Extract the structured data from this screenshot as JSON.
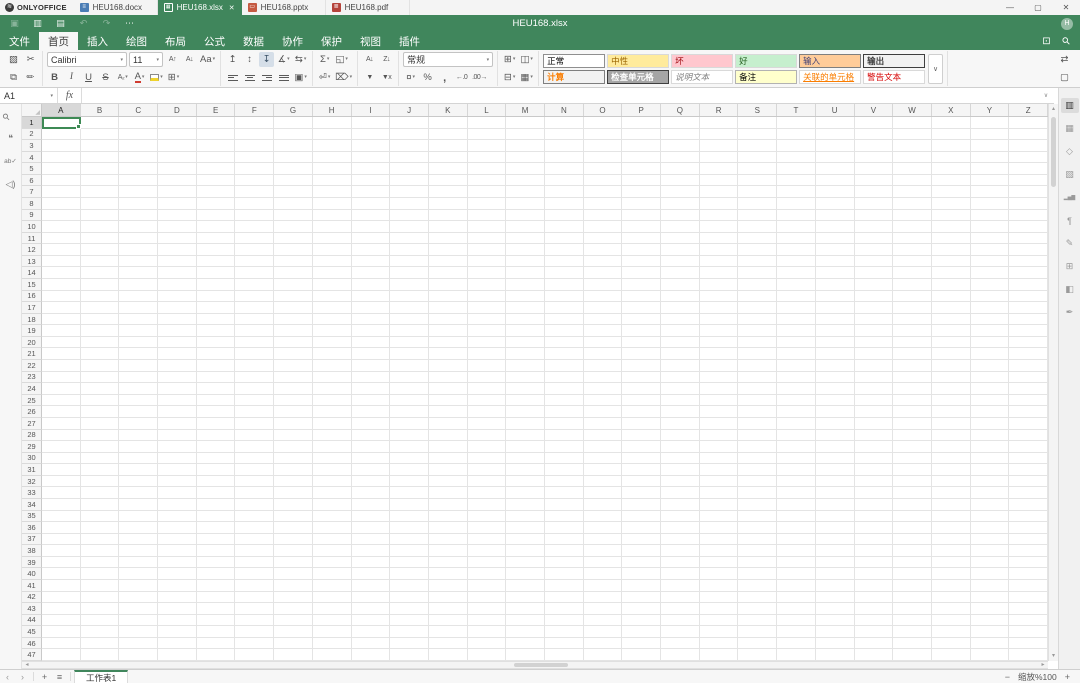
{
  "window": {
    "brand": "ONLYOFFICE",
    "logo_glyph": "≋",
    "tabs": [
      {
        "id": "docx",
        "label": "HEU168.docx",
        "icon_color": "#4a7db5",
        "icon_glyph": "≡",
        "active": false
      },
      {
        "id": "xlsx",
        "label": "HEU168.xlsx",
        "icon_color": "#40865c",
        "icon_glyph": "▦",
        "active": true,
        "close_glyph": "✕"
      },
      {
        "id": "pptx",
        "label": "HEU168.pptx",
        "icon_color": "#c55a42",
        "icon_glyph": "▭",
        "active": false
      },
      {
        "id": "pdf",
        "label": "HEU168.pdf",
        "icon_color": "#b5433b",
        "icon_glyph": "≣",
        "active": false
      }
    ],
    "controls": {
      "minimize": "—",
      "maximize": "▢",
      "close": "✕"
    }
  },
  "header": {
    "title": "HEU168.xlsx",
    "avatar_initial": "H"
  },
  "quick_access": {
    "save": "▣",
    "print": "▥",
    "quick_print": "▤",
    "undo": "↶",
    "redo": "↷",
    "more": "⋯"
  },
  "menu": {
    "items": [
      {
        "id": "file",
        "label": "文件",
        "active": false
      },
      {
        "id": "home",
        "label": "首页",
        "active": true
      },
      {
        "id": "insert",
        "label": "插入",
        "active": false
      },
      {
        "id": "draw",
        "label": "绘图",
        "active": false
      },
      {
        "id": "layout",
        "label": "布局",
        "active": false
      },
      {
        "id": "formula",
        "label": "公式",
        "active": false
      },
      {
        "id": "data",
        "label": "数据",
        "active": false
      },
      {
        "id": "collaboration",
        "label": "协作",
        "active": false
      },
      {
        "id": "protection",
        "label": "保护",
        "active": false
      },
      {
        "id": "view",
        "label": "视图",
        "active": false
      },
      {
        "id": "plugins",
        "label": "插件",
        "active": false
      }
    ],
    "right_icons": {
      "open_location": "⊡",
      "search": "⚲"
    }
  },
  "toolbar": {
    "font_name": "Calibri",
    "font_size": "11",
    "number_format": "常规",
    "icons": {
      "paste": "▧",
      "cut": "✂",
      "copy": "⧉",
      "format_painter": "✏",
      "font_grow": "A↑",
      "font_shrink": "A↓",
      "change_case": "Aa",
      "bold": "B",
      "italic": "I",
      "underline": "U",
      "strike": "S",
      "subscript": "A₂",
      "font_color": "A",
      "borders": "⊞",
      "valign_top": "↥",
      "valign_middle": "↕",
      "valign_bottom": "↧",
      "orientation": "∡",
      "text_direction": "⇆",
      "merge": "▣",
      "autosum": "Σ",
      "named_ranges": "◱",
      "wrap_text": "⏎",
      "clear": "⌦",
      "sort_asc": "A↓",
      "sort_desc": "Z↓",
      "filter": "▼",
      "clear_filter": "▼x",
      "accounting": "¤",
      "percent": "%",
      "comma": ",",
      "dec_decimal": "←.0",
      "inc_decimal": ".00→",
      "insert_cells": "⊞",
      "delete_cells": "⊟",
      "cond_format": "◫",
      "table_template": "▦",
      "gallery_expand": "∨",
      "replace": "⇄",
      "select_range": "▢",
      "dropdown": "▾"
    }
  },
  "style_gallery": {
    "rows": [
      [
        {
          "id": "normal",
          "label": "正常",
          "bg": "#ffffff",
          "fg": "#000000",
          "border": "#8f8f8f"
        },
        {
          "id": "neutral",
          "label": "中性",
          "bg": "#ffeb9c",
          "fg": "#9c6500"
        },
        {
          "id": "bad",
          "label": "坏",
          "bg": "#ffc7ce",
          "fg": "#9c0006"
        },
        {
          "id": "good",
          "label": "好",
          "bg": "#c6efce",
          "fg": "#276221"
        },
        {
          "id": "input",
          "label": "输入",
          "bg": "#ffcc99",
          "fg": "#3f3f76",
          "border": "#7f7f7f"
        },
        {
          "id": "output",
          "label": "输出",
          "bg": "#f2f2f2",
          "fg": "#3f3f3f",
          "border": "#3f3f3f",
          "bold": true
        }
      ],
      [
        {
          "id": "calculation",
          "label": "计算",
          "bg": "#f2f2f2",
          "fg": "#fa7d00",
          "border": "#7f7f7f",
          "bold": true
        },
        {
          "id": "check-cell",
          "label": "检查单元格",
          "bg": "#a5a5a5",
          "fg": "#ffffff",
          "border": "#3f3f3f",
          "bold": true
        },
        {
          "id": "explanatory-text",
          "label": "说明文本",
          "bg": "#ffffff",
          "fg": "#7f7f7f",
          "italic": true
        },
        {
          "id": "note",
          "label": "备注",
          "bg": "#ffffcc",
          "fg": "#000000",
          "border": "#b2b2b2"
        },
        {
          "id": "linked-cell",
          "label": "关联的单元格",
          "bg": "#ffffff",
          "fg": "#fa7d00",
          "underline": true
        },
        {
          "id": "warning-text",
          "label": "警告文本",
          "bg": "#ffffff",
          "fg": "#d60000"
        }
      ]
    ]
  },
  "formula_bar": {
    "name_box": "A1",
    "fx_label": "fx",
    "value": "",
    "expand": "∨"
  },
  "left_sidebar": {
    "items": [
      {
        "id": "search",
        "glyph": "⚲"
      },
      {
        "id": "comments",
        "glyph": "❝"
      },
      {
        "id": "spellcheck",
        "glyph": "ab✓"
      },
      {
        "id": "feedback",
        "glyph": "◁)"
      }
    ]
  },
  "right_sidebar": {
    "items": [
      {
        "id": "cell-settings",
        "glyph": "▥",
        "active": true
      },
      {
        "id": "table-settings",
        "glyph": "▦",
        "active": false
      },
      {
        "id": "shape-settings",
        "glyph": "◇",
        "active": false
      },
      {
        "id": "image-settings",
        "glyph": "▧",
        "active": false
      },
      {
        "id": "chart-settings",
        "glyph": "▂▅▇",
        "active": false
      },
      {
        "id": "paragraph-settings",
        "glyph": "¶",
        "active": false
      },
      {
        "id": "textart-settings",
        "glyph": "✎",
        "active": false
      },
      {
        "id": "pivot-settings",
        "glyph": "⊞",
        "active": false
      },
      {
        "id": "slicer-settings",
        "glyph": "◧",
        "active": false
      },
      {
        "id": "signature-settings",
        "glyph": "✒",
        "active": false
      }
    ]
  },
  "grid": {
    "columns": [
      "A",
      "B",
      "C",
      "D",
      "E",
      "F",
      "G",
      "H",
      "I",
      "J",
      "K",
      "L",
      "M",
      "N",
      "O",
      "P",
      "Q",
      "R",
      "S",
      "T",
      "U",
      "V",
      "W",
      "X",
      "Y",
      "Z"
    ],
    "row_count": 47,
    "selected_cell": "A1",
    "selected_column": "A",
    "selected_row": 1
  },
  "scroll": {
    "up": "▴",
    "down": "▾",
    "left": "◂",
    "right": "▸"
  },
  "sheet_bar": {
    "nav_prev": "‹",
    "nav_next": "›",
    "add_sheet": "+",
    "sheet_list": "≡",
    "sheet_name": "工作表1"
  },
  "status_bar": {
    "zoom_out": "−",
    "zoom_label": "缩放%100",
    "zoom_in": "+"
  },
  "colors": {
    "accent_green": "#40865c",
    "selection_green": "#3e8a55"
  }
}
